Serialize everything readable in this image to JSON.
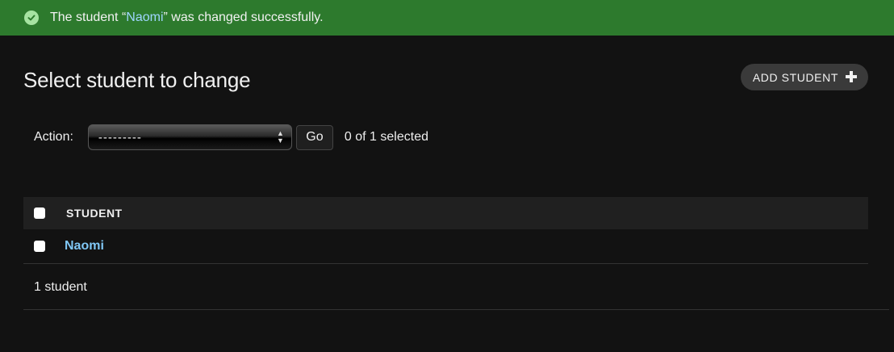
{
  "message": {
    "prefix": "The student “",
    "link": "Naomi",
    "suffix": "” was changed successfully.",
    "icon": "check-circle-icon"
  },
  "page_title": "Select student to change",
  "add_button": {
    "label": "ADD STUDENT",
    "icon": "plus-icon"
  },
  "actions": {
    "label": "Action:",
    "selected_option": "---------",
    "go_label": "Go",
    "selected_count": "0 of 1 selected"
  },
  "table": {
    "column_header": "STUDENT",
    "rows": [
      {
        "name": "Naomi"
      }
    ]
  },
  "paginator": {
    "count_text": "1 student"
  },
  "colors": {
    "success_bg": "#2d7a2d",
    "link": "#80c7f5",
    "background": "#121212"
  }
}
